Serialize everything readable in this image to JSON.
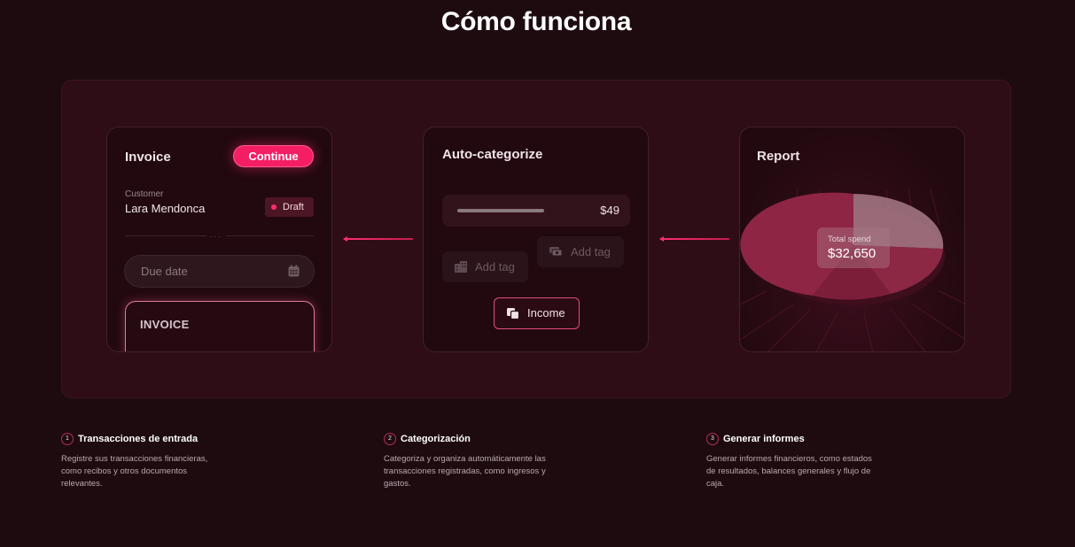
{
  "page": {
    "title": "Cómo funciona"
  },
  "invoice_card": {
    "title": "Invoice",
    "continue_label": "Continue",
    "customer_label": "Customer",
    "customer_name": "Lara Mendonca",
    "status_badge": "Draft",
    "divider_text": "...",
    "due_date_placeholder": "Due date",
    "document_label": "INVOICE",
    "accent_color": "#f41e65"
  },
  "autocategorize_card": {
    "title": "Auto-categorize",
    "amount": "$49",
    "tags": [
      {
        "label": "Add tag",
        "icon": "building-icon"
      },
      {
        "label": "Add tag",
        "icon": "cash-icon"
      }
    ],
    "income_button": {
      "label": "Income",
      "icon": "copy-icon"
    }
  },
  "report_card": {
    "title": "Report",
    "total_label": "Total spend",
    "total_value": "$32,650",
    "chart_type": "pie"
  },
  "steps": [
    {
      "number": "1",
      "title": "Transacciones de entrada",
      "description": "Registre sus transacciones financieras, como recibos y otros documentos relevantes."
    },
    {
      "number": "2",
      "title": "Categorización",
      "description": "Categoriza y organiza automáticamente las transacciones registradas, como ingresos y gastos."
    },
    {
      "number": "3",
      "title": "Generar informes",
      "description": "Generar informes financieros, como estados de resultados, balances generales y flujo de caja."
    }
  ]
}
